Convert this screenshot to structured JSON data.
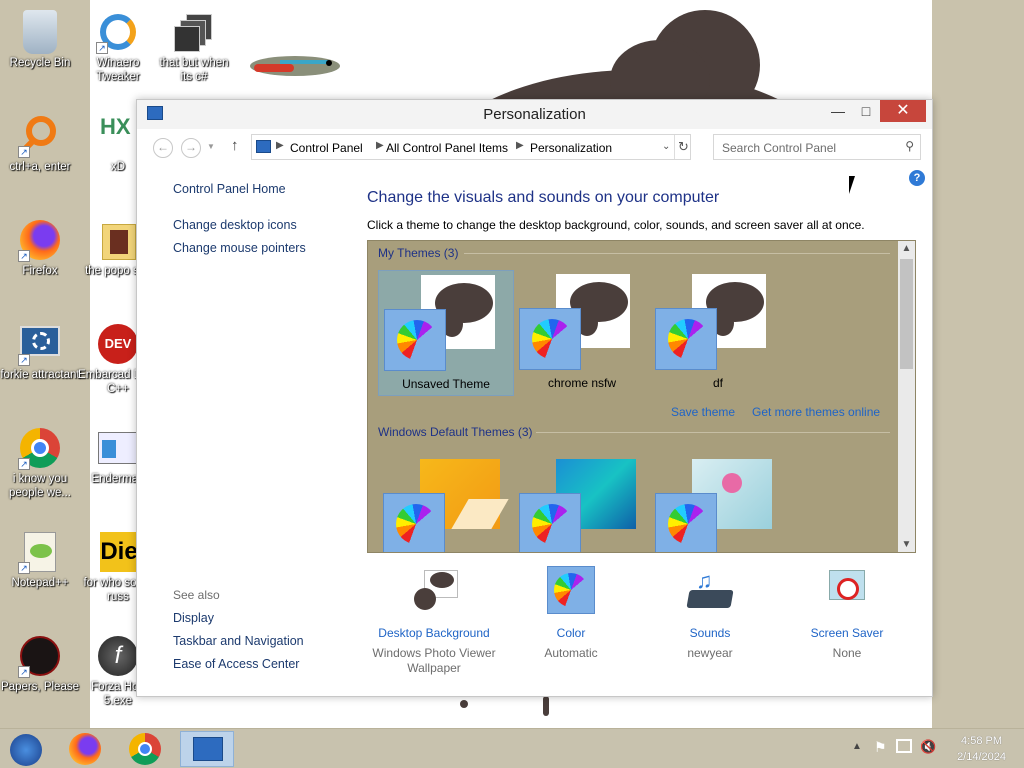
{
  "desktop": {
    "icons": [
      {
        "label": "Recycle Bin"
      },
      {
        "label": "Winaero Tweaker"
      },
      {
        "label": "that but when its c#"
      },
      {
        "label": "ctrl+a, enter"
      },
      {
        "label": "xD"
      },
      {
        "label": "Firefox"
      },
      {
        "label": "the popo shit"
      },
      {
        "label": "forkie attractant"
      },
      {
        "label": "Embarcad Dev-C++"
      },
      {
        "label": "i know you people we..."
      },
      {
        "label": "Enderman"
      },
      {
        "label": "Notepad++"
      },
      {
        "label": "for who some russ"
      },
      {
        "label": "Papers, Please"
      },
      {
        "label": "Forza Hori 5.exe"
      }
    ]
  },
  "window": {
    "title": "Personalization",
    "address": {
      "crumbs": [
        "Control Panel",
        "All Control Panel Items",
        "Personalization"
      ]
    },
    "search_placeholder": "Search Control Panel",
    "left_nav": {
      "home": "Control Panel Home",
      "links": [
        "Change desktop icons",
        "Change mouse pointers"
      ],
      "see_also_title": "See also",
      "see_also": [
        "Display",
        "Taskbar and Navigation",
        "Ease of Access Center"
      ]
    },
    "main": {
      "heading": "Change the visuals and sounds on your computer",
      "subheading": "Click a theme to change the desktop background, color, sounds, and screen saver all at once.",
      "my_themes_label": "My Themes (3)",
      "my_themes": [
        {
          "name": "Unsaved Theme",
          "selected": true
        },
        {
          "name": "chrome nsfw",
          "selected": false
        },
        {
          "name": "df",
          "selected": false
        }
      ],
      "save_theme": "Save theme",
      "get_more": "Get more themes online",
      "default_themes_label": "Windows Default Themes (3)"
    },
    "settings": [
      {
        "label": "Desktop Background",
        "value": "Windows Photo Viewer Wallpaper"
      },
      {
        "label": "Color",
        "value": "Automatic"
      },
      {
        "label": "Sounds",
        "value": "newyear"
      },
      {
        "label": "Screen Saver",
        "value": "None"
      }
    ],
    "help_icon": "?"
  },
  "taskbar": {
    "time": "4:58 PM",
    "date": "2/14/2024"
  }
}
